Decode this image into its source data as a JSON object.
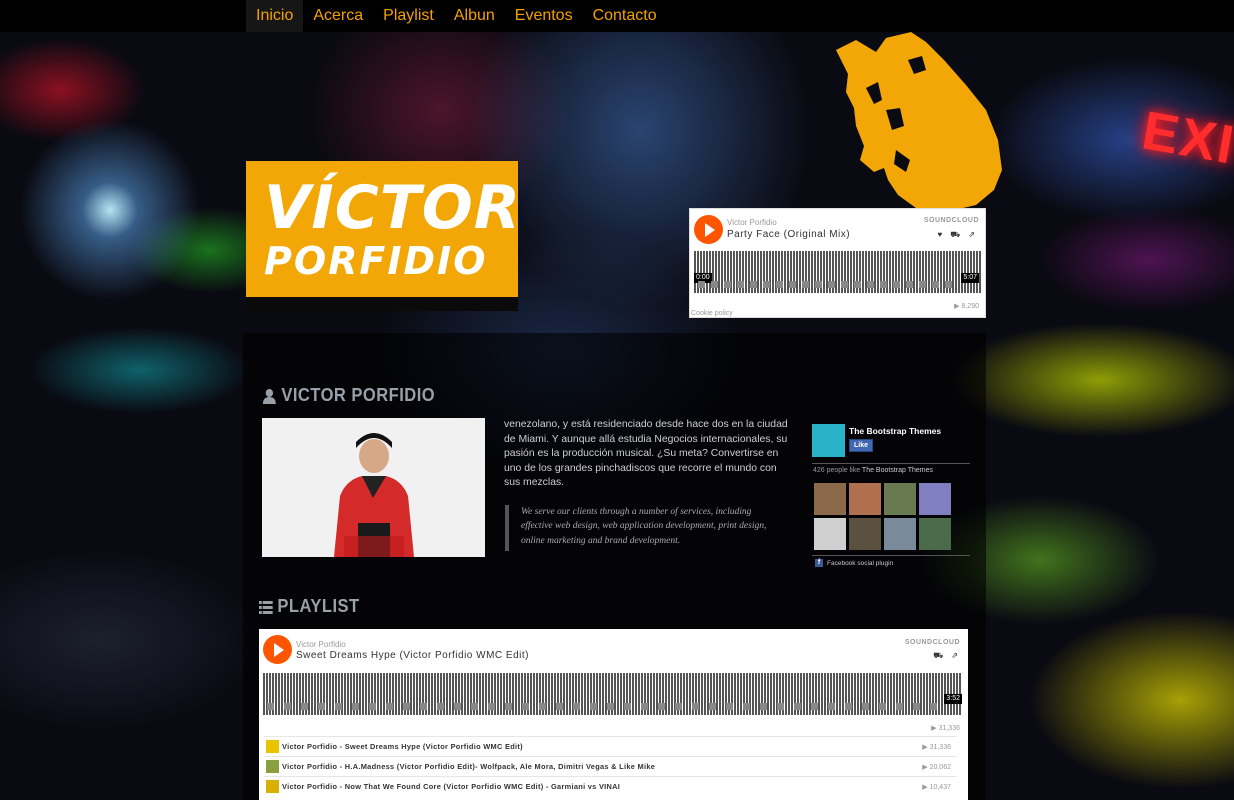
{
  "nav": {
    "items": [
      {
        "label": "Inicio",
        "active": true
      },
      {
        "label": "Acerca",
        "active": false
      },
      {
        "label": "Playlist",
        "active": false
      },
      {
        "label": "Albun",
        "active": false
      },
      {
        "label": "Eventos",
        "active": false
      },
      {
        "label": "Contacto",
        "active": false
      }
    ]
  },
  "hero": {
    "exit_sign": "EXIT",
    "logo_line1": "VÍCTOR",
    "logo_line2": "PORFIDIO"
  },
  "header_player": {
    "artist": "Victor Porfidio",
    "title": "Party Face (Original Mix)",
    "brand": "SOUNDCLOUD",
    "time_start": "0:00",
    "time_end": "5:07",
    "plays": "8,290",
    "cookie": "Cookie policy",
    "progress": 0.0
  },
  "about": {
    "heading": "VICTOR PORFIDIO",
    "bio": "venezolano, y está residenciado desde hace dos en la ciudad de Miami. Y aunque allá estudia Negocios internacionales, su pasión es la producción musical. ¿Su meta? Convertirse en uno de los grandes pinchadiscos que recorre el mundo con sus mezclas.",
    "quote": "We serve our clients through a number of services, including effective web design, web application development, print design, online marketing and brand development."
  },
  "facebook": {
    "page_name": "The Bootstrap Themes",
    "like_label": "Like",
    "count_text": "426 people like",
    "count_page": "The Bootstrap Themes",
    "plugin_label": "Facebook social plugin",
    "face_colors": [
      "#8a6a4a",
      "#b07050",
      "#6a7a50",
      "#8080c0",
      "#d0d0d0",
      "#5a5040",
      "#7a8a9a",
      "#4a6a4a"
    ]
  },
  "playlist": {
    "heading": "PLAYLIST",
    "player": {
      "artist": "Victor Porfidio",
      "title": "Sweet Dreams Hype (Victor Porfidio WMC Edit)",
      "brand": "SOUNDCLOUD",
      "time_end": "3:52",
      "plays": "31,336"
    },
    "tracks": [
      {
        "name": "Victor Porfidio - Sweet Dreams Hype (Victor Porfidio WMC Edit)",
        "plays": "31,336",
        "color": "#e8c400"
      },
      {
        "name": "Victor Porfidio - H.A.Madness (Victor Porfidio Edit)- Wolfpack, Ale Mora, Dimitri Vegas & Like Mike",
        "plays": "20,062",
        "color": "#8aa040"
      },
      {
        "name": "Victor Porfidio - Now That We Found Core (Victor Porfidio WMC Edit) - Garmiani vs VINAI",
        "plays": "10,437",
        "color": "#d8b000"
      }
    ]
  },
  "colors": {
    "accent": "#f2a706",
    "soundcloud": "#ff5500"
  }
}
